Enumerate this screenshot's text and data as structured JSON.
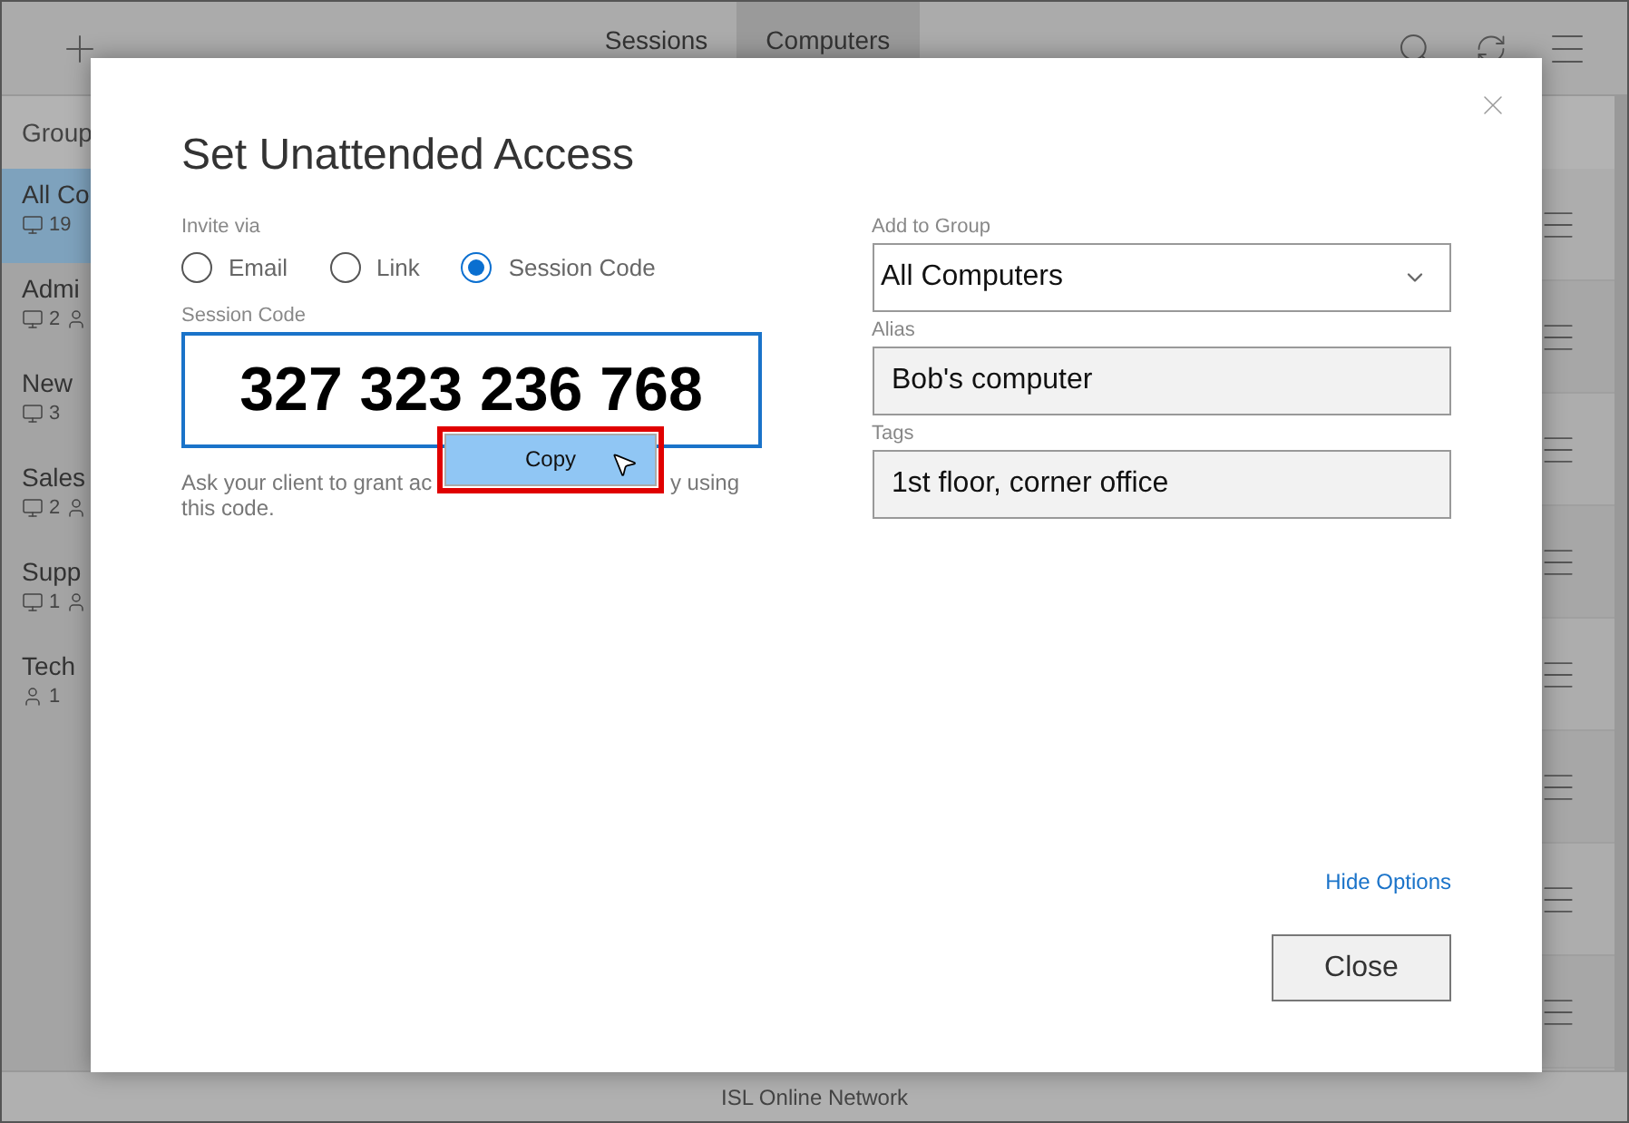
{
  "toolbar": {
    "tabs": [
      {
        "label": "Sessions",
        "selected": false
      },
      {
        "label": "Computers",
        "selected": true
      }
    ]
  },
  "sidebar": {
    "header": "Group",
    "items": [
      {
        "name": "All Co",
        "selected": true,
        "counts": [
          {
            "kind": "computers",
            "value": "19"
          }
        ]
      },
      {
        "name": "Admi",
        "selected": false,
        "counts": [
          {
            "kind": "computers",
            "value": "2"
          },
          {
            "kind": "users"
          }
        ]
      },
      {
        "name": "New",
        "selected": false,
        "counts": [
          {
            "kind": "computers",
            "value": "3"
          }
        ]
      },
      {
        "name": "Sales",
        "selected": false,
        "counts": [
          {
            "kind": "computers",
            "value": "2"
          },
          {
            "kind": "users"
          }
        ]
      },
      {
        "name": "Supp",
        "selected": false,
        "counts": [
          {
            "kind": "computers",
            "value": "1"
          },
          {
            "kind": "users"
          }
        ]
      },
      {
        "name": "Tech",
        "selected": false,
        "counts": [
          {
            "kind": "users",
            "value": "1"
          }
        ]
      }
    ]
  },
  "dialog": {
    "title": "Set Unattended Access",
    "invite_label": "Invite via",
    "invite_options": [
      {
        "label": "Email",
        "selected": false
      },
      {
        "label": "Link",
        "selected": false
      },
      {
        "label": "Session Code",
        "selected": true
      }
    ],
    "session_code_label": "Session Code",
    "session_code": "327 323 236 768",
    "copy_button": "Copy",
    "hint": {
      "line_1_left": "Ask your client to grant ac",
      "line_1_right": "y using",
      "line_2": "this code."
    },
    "group_label": "Add to Group",
    "group_value": "All Computers",
    "alias_label": "Alias",
    "alias_value": "Bob's computer",
    "tags_label": "Tags",
    "tags_value": "1st floor, corner office",
    "hide_options": "Hide Options",
    "close_button": "Close"
  },
  "status_bar": "ISL Online Network"
}
